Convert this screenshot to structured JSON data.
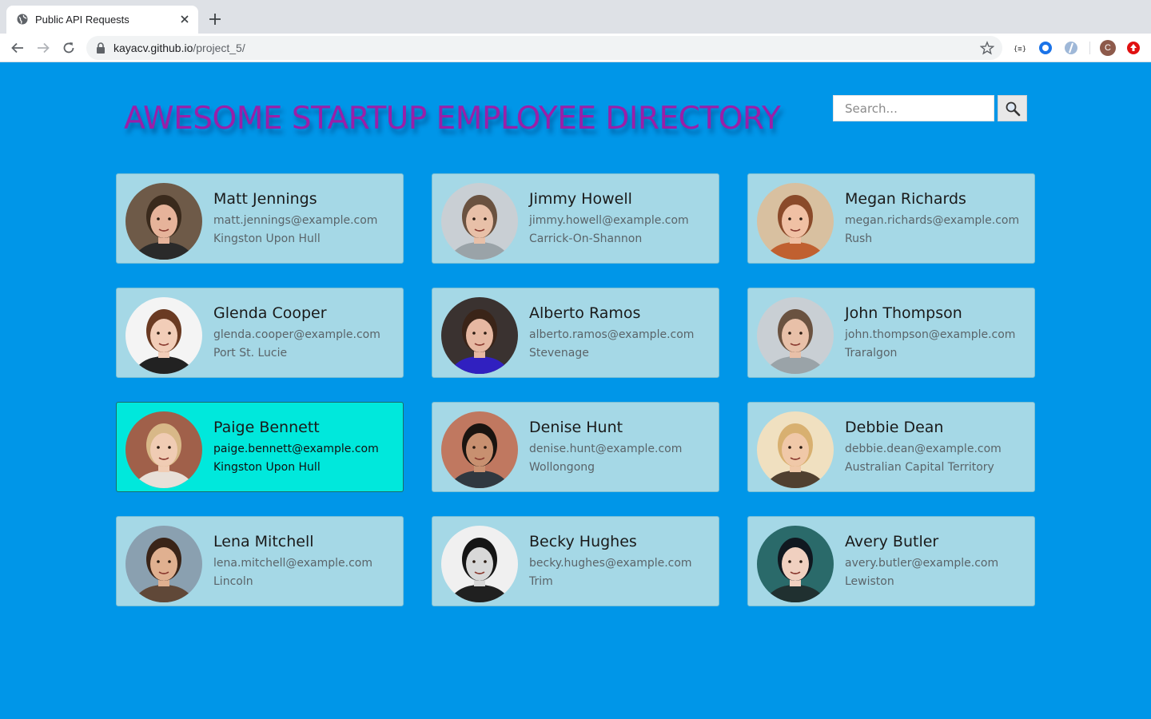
{
  "browser": {
    "tab_title": "Public API Requests",
    "url_host": "kayacv.github.io",
    "url_path": "/project_5/",
    "profile_initial": "C"
  },
  "page": {
    "title": "AWESOME STARTUP EMPLOYEE DIRECTORY",
    "search_placeholder": "Search...",
    "title_color": "#9a1fa8",
    "background_color": "#0096e8",
    "card_color": "#a5d8e6",
    "active_card_color": "#00e8dc"
  },
  "employees": [
    {
      "name": "Matt Jennings",
      "email": "matt.jennings@example.com",
      "city": "Kingston Upon Hull",
      "active": false,
      "skin": "#e6b39a",
      "hair": "#3a2a1c",
      "bg": "#6e5a48",
      "shirt": "#2a2a2a"
    },
    {
      "name": "Jimmy Howell",
      "email": "jimmy.howell@example.com",
      "city": "Carrick-On-Shannon",
      "active": false,
      "skin": "#e8c0a8",
      "hair": "#6a5240",
      "bg": "#c9cfd4",
      "shirt": "#9aa3a8"
    },
    {
      "name": "Megan Richards",
      "email": "megan.richards@example.com",
      "city": "Rush",
      "active": false,
      "skin": "#f0c0a4",
      "hair": "#8a4a2a",
      "bg": "#d8c0a0",
      "shirt": "#c06030"
    },
    {
      "name": "Glenda Cooper",
      "email": "glenda.cooper@example.com",
      "city": "Port St. Lucie",
      "active": false,
      "skin": "#f2cdb8",
      "hair": "#6a3a22",
      "bg": "#f4f4f4",
      "shirt": "#222222"
    },
    {
      "name": "Alberto Ramos",
      "email": "alberto.ramos@example.com",
      "city": "Stevenage",
      "active": false,
      "skin": "#e6b8a2",
      "hair": "#3a2418",
      "bg": "#3a3230",
      "shirt": "#3020c0"
    },
    {
      "name": "John Thompson",
      "email": "john.thompson@example.com",
      "city": "Traralgon",
      "active": false,
      "skin": "#e8c0a8",
      "hair": "#6a5240",
      "bg": "#c9cfd4",
      "shirt": "#9aa3a8"
    },
    {
      "name": "Paige Bennett",
      "email": "paige.bennett@example.com",
      "city": "Kingston Upon Hull",
      "active": true,
      "skin": "#f0ccb4",
      "hair": "#d8b888",
      "bg": "#a0604a",
      "shirt": "#e8e0d8"
    },
    {
      "name": "Denise Hunt",
      "email": "denise.hunt@example.com",
      "city": "Wollongong",
      "active": false,
      "skin": "#c89070",
      "hair": "#1a1410",
      "bg": "#c07860",
      "shirt": "#303840"
    },
    {
      "name": "Debbie Dean",
      "email": "debbie.dean@example.com",
      "city": "Australian Capital Territory",
      "active": false,
      "skin": "#f0c8a8",
      "hair": "#d8b070",
      "bg": "#f0e0c0",
      "shirt": "#504030"
    },
    {
      "name": "Lena Mitchell",
      "email": "lena.mitchell@example.com",
      "city": "Lincoln",
      "active": false,
      "skin": "#e0b090",
      "hair": "#3a2418",
      "bg": "#8aa0b0",
      "shirt": "#604838"
    },
    {
      "name": "Becky Hughes",
      "email": "becky.hughes@example.com",
      "city": "Trim",
      "active": false,
      "skin": "#d8d8d8",
      "hair": "#151515",
      "bg": "#f0f0f0",
      "shirt": "#202020"
    },
    {
      "name": "Avery Butler",
      "email": "avery.butler@example.com",
      "city": "Lewiston",
      "active": false,
      "skin": "#f0d0c0",
      "hair": "#101820",
      "bg": "#2a6a6a",
      "shirt": "#203030"
    }
  ]
}
